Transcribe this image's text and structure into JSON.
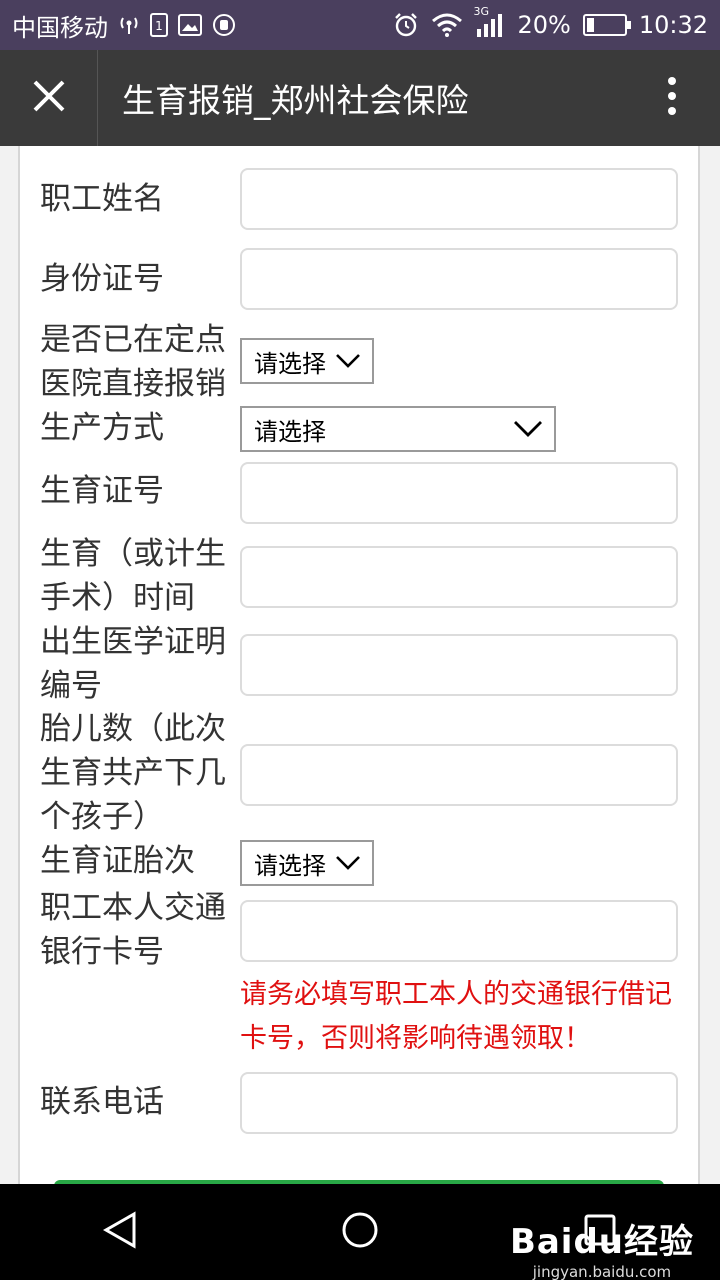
{
  "status": {
    "carrier": "中国移动",
    "network": "3G",
    "battery": "20%",
    "battery_level": 0.2,
    "time": "10:32"
  },
  "titlebar": {
    "title": "生育报销_郑州社会保险"
  },
  "form": {
    "employee_name": {
      "label": "职工姓名",
      "value": ""
    },
    "id_number": {
      "label": "身份证号",
      "value": ""
    },
    "direct_reimburse": {
      "label": "是否已在定点医院直接报销",
      "selected": "请选择"
    },
    "delivery_method": {
      "label": "生产方式",
      "selected": "请选择"
    },
    "birth_cert_number": {
      "label": "生育证号",
      "value": ""
    },
    "birth_time": {
      "label": "生育（或计生手术）时间",
      "value": ""
    },
    "medical_birth_cert": {
      "label": "出生医学证明编号",
      "value": ""
    },
    "fetus_count": {
      "label": "胎儿数（此次生育共产下几个孩子）",
      "value": ""
    },
    "birth_order": {
      "label": "生育证胎次",
      "selected": "请选择"
    },
    "bank_card": {
      "label": "职工本人交通银行卡号",
      "value": ""
    },
    "bank_note": "请务必填写职工本人的交通银行借记卡号，否则将影响待遇领取！",
    "phone": {
      "label": "联系电话",
      "value": ""
    }
  },
  "watermark": {
    "brand": "Baidu经验",
    "url": "jingyan.baidu.com"
  }
}
